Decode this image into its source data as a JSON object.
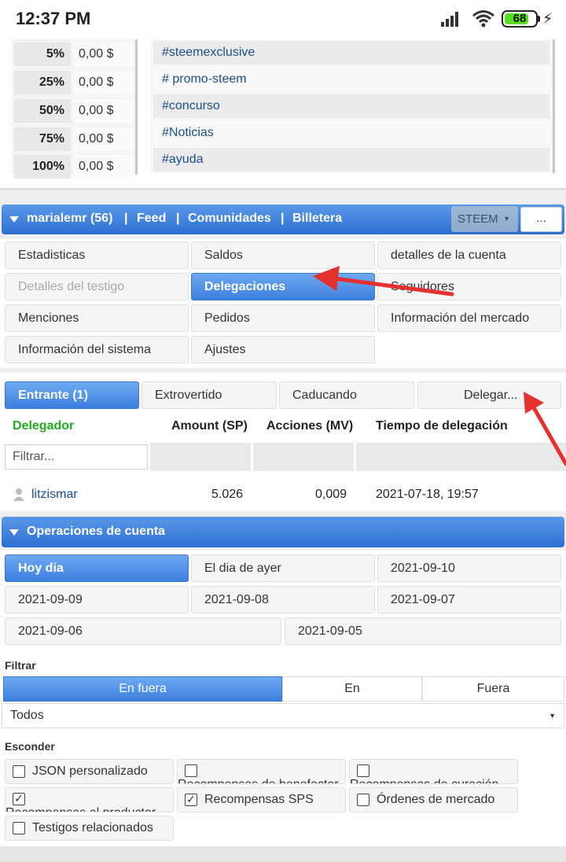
{
  "status_bar": {
    "time": "12:37 PM",
    "battery": "68",
    "icons": [
      "signal-icon",
      "wifi-icon",
      "battery-icon",
      "charging-icon"
    ]
  },
  "percent_table": [
    {
      "pct": "5%",
      "value": "0,00 $"
    },
    {
      "pct": "25%",
      "value": "0,00 $"
    },
    {
      "pct": "50%",
      "value": "0,00 $"
    },
    {
      "pct": "75%",
      "value": "0,00 $"
    },
    {
      "pct": "100%",
      "value": "0,00 $"
    }
  ],
  "tags": [
    "#steemexclusive",
    "# promo-steem",
    "#concurso",
    "#Noticias",
    "#ayuda"
  ],
  "nav": {
    "user": "marialemr (56)",
    "sep": "|",
    "feed": "Feed",
    "communities": "Comunidades",
    "wallet": "Billetera",
    "currency": "STEEM",
    "more": "..."
  },
  "menu": {
    "estadisticas": "Estadisticas",
    "saldos": "Saldos",
    "detalles_cuenta": "detalles de la cuenta",
    "detalles_testigo": "Detalles del testigo",
    "delegaciones": "Delegaciones",
    "seguidores": "Seguidores",
    "menciones": "Menciones",
    "pedidos": "Pedidos",
    "info_mercado": "Información del mercado",
    "info_sistema": "Información del sistema",
    "ajustes": "Ajustes"
  },
  "delegation_tabs": {
    "entrante": "Entrante (1)",
    "extrovertido": "Extrovertido",
    "caducando": "Caducando",
    "delegar": "Delegar..."
  },
  "delegation_table": {
    "headers": {
      "delegador": "Delegador",
      "amount": "Amount (SP)",
      "acciones": "Acciones (MV)",
      "tiempo": "Tiempo de delegación"
    },
    "filter_placeholder": "Filtrar...",
    "rows": [
      {
        "delegador": "litzismar",
        "amount": "5.026",
        "acciones": "0,009",
        "tiempo": "2021-07-18, 19:57"
      }
    ]
  },
  "operations": {
    "title": "Operaciones de cuenta",
    "dates": {
      "hoy": "Hoy dia",
      "ayer": "El dia de ayer",
      "d10": "2021-09-10",
      "d09": "2021-09-09",
      "d08": "2021-09-08",
      "d07": "2021-09-07",
      "d06": "2021-09-06",
      "d05": "2021-09-05"
    },
    "filter_label": "Filtrar",
    "direction": {
      "both": "En fuera",
      "in": "En",
      "out": "Fuera"
    },
    "type_select": "Todos",
    "hide_label": "Esconder",
    "hide_options": {
      "json": "JSON personalizado",
      "benefactor": "Recompensas de benefactor",
      "curacion": "Recompensas de curación",
      "productor": "Recompensas al productor",
      "sps": "Recompensas SPS",
      "ordenes": "Órdenes de mercado",
      "testigos": "Testigos relacionados"
    }
  },
  "colors": {
    "accent_blue": "#3c7fdd",
    "link_blue": "#1a4e8a",
    "delegator_green": "#22aa22"
  }
}
